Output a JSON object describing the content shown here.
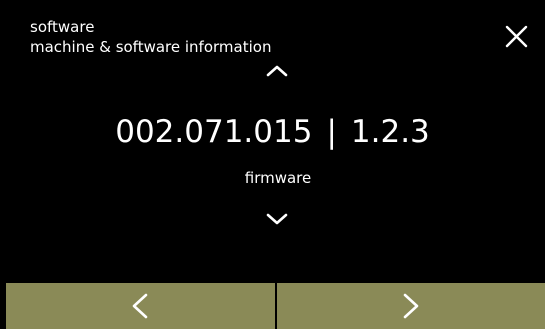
{
  "header": {
    "title": "software",
    "subtitle": "machine & software information"
  },
  "main": {
    "version_primary": "002.071.015",
    "separator": "|",
    "version_secondary": "1.2.3",
    "caption": "firmware"
  },
  "icons": {
    "close": "close-icon",
    "up": "chevron-up-icon",
    "down": "chevron-down-icon",
    "prev": "chevron-left-icon",
    "next": "chevron-right-icon"
  },
  "colors": {
    "background": "#000000",
    "text": "#ffffff",
    "footer_button": "#8a8a57"
  }
}
